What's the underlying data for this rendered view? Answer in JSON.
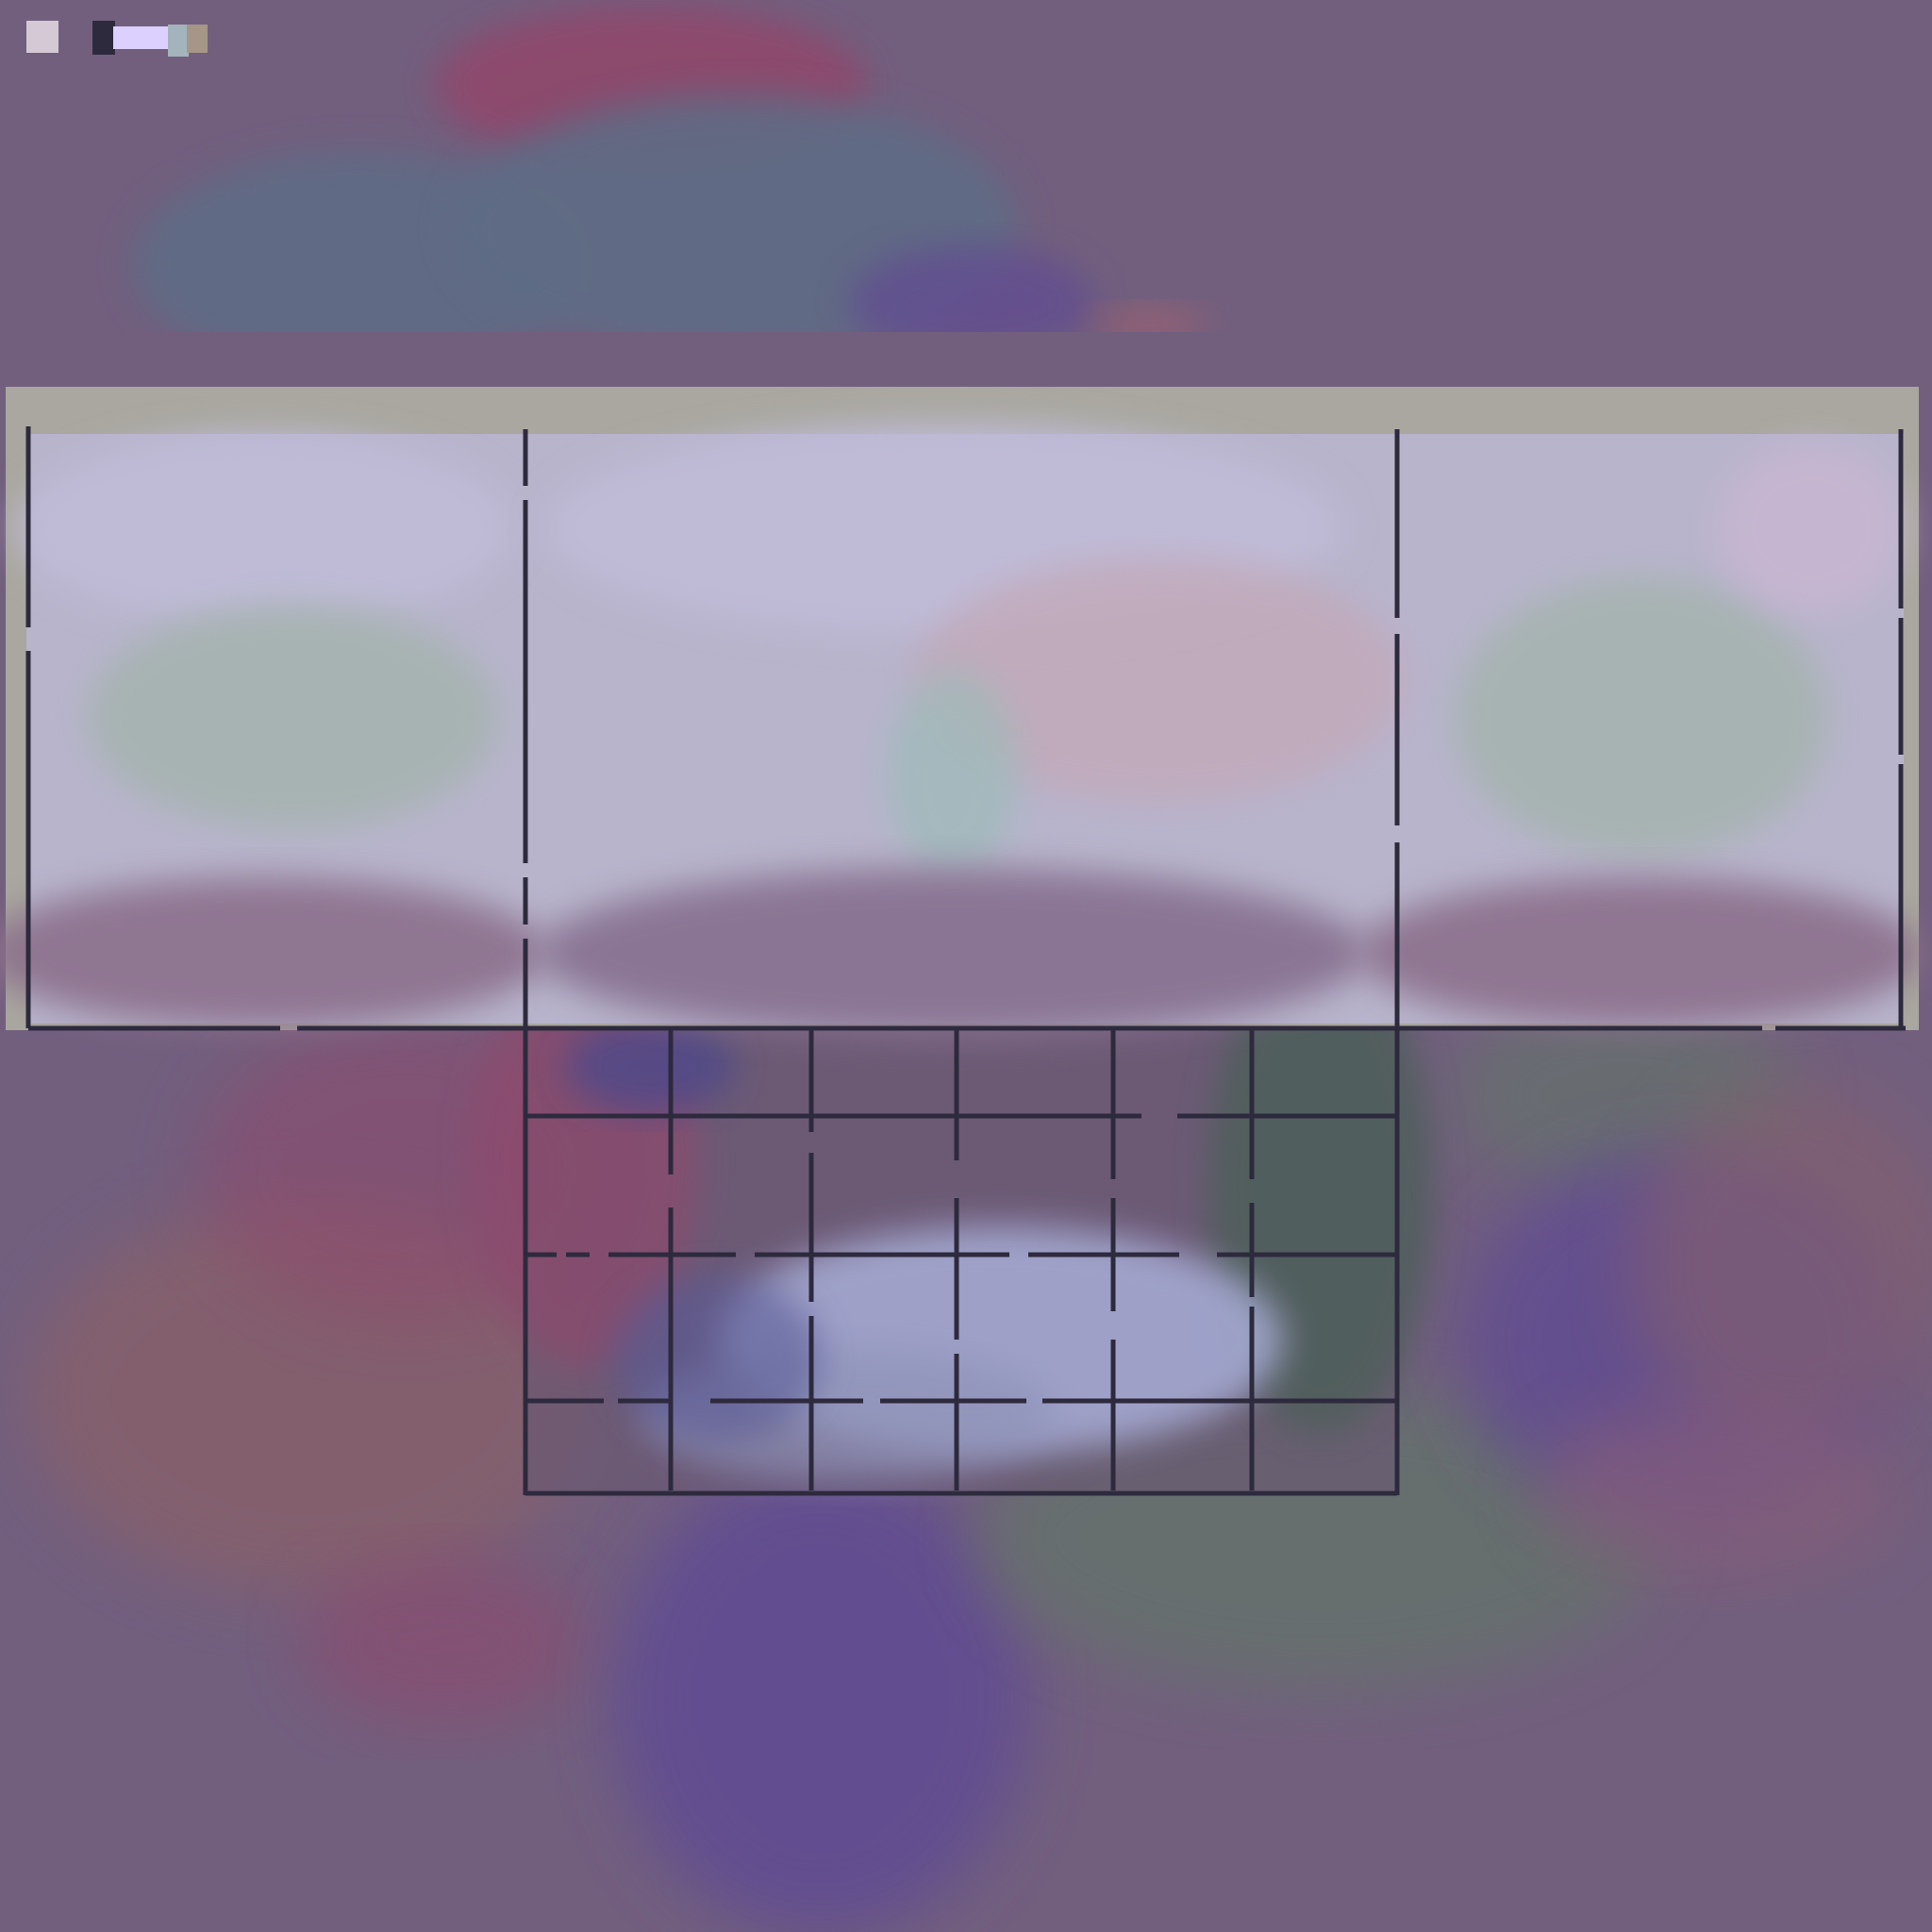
{
  "palette": {
    "swatches": [
      {
        "name": "pale-lilac",
        "color": "#d6c9d6"
      },
      {
        "name": "ink",
        "color": "#2e2a3e"
      },
      {
        "name": "lavender",
        "color": "#dcd0ff"
      },
      {
        "name": "blue-gray",
        "color": "#a3b4bc"
      },
      {
        "name": "taupe",
        "color": "#a59687"
      }
    ]
  },
  "colors": {
    "background": "#725f7e",
    "line": "#2e2a3e",
    "panel_frame": "#a9a79f",
    "cloud_red": "#8e4a6d",
    "cloud_slate": "#5f6c85",
    "cloud_violet": "#624e91",
    "cloud_green": "#66706e",
    "cloud_rose": "#85616d",
    "mist_lilac": "#bfbbd7",
    "mist_sage": "#a6b3b0"
  }
}
